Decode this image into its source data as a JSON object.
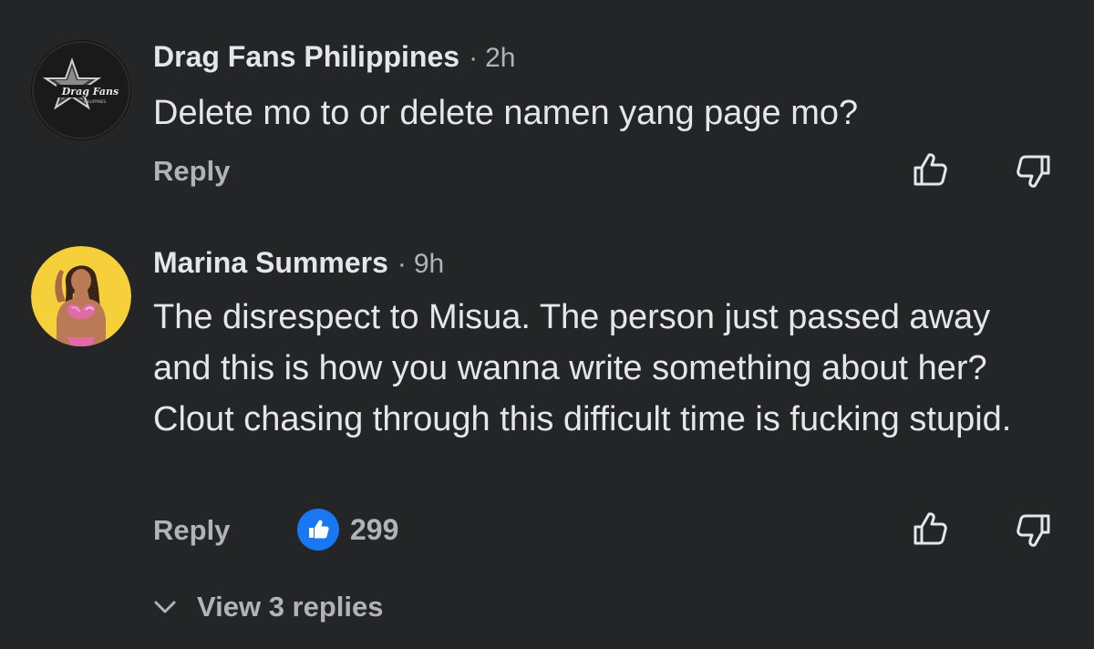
{
  "comments": [
    {
      "author": "Drag Fans Philippines",
      "separator": "·",
      "time": "2h",
      "text": "Delete mo to or delete namen yang page mo?",
      "reply_label": "Reply",
      "avatar": {
        "logo_text": "Drag Fans",
        "logo_subtext": "PHILIPPINES",
        "icon": "star-logo"
      },
      "actions": {
        "like_icon": "thumbs-up-icon",
        "dislike_icon": "thumbs-down-icon"
      }
    },
    {
      "author": "Marina Summers",
      "separator": "·",
      "time": "9h",
      "text": "The disrespect to Misua. The person just passed away and this is how you wanna write something about her? Clout chasing through this difficult time is fucking stupid.",
      "reply_label": "Reply",
      "reaction": {
        "icon": "like-icon",
        "count": "299"
      },
      "actions": {
        "like_icon": "thumbs-up-icon",
        "dislike_icon": "thumbs-down-icon"
      },
      "view_replies_label": "View 3 replies"
    }
  ],
  "colors": {
    "background": "#242526",
    "primary_text": "#e4e6eb",
    "secondary_text": "#b0b3b8",
    "like_blue": "#1877f2",
    "avatar_yellow": "#f5d03a"
  }
}
